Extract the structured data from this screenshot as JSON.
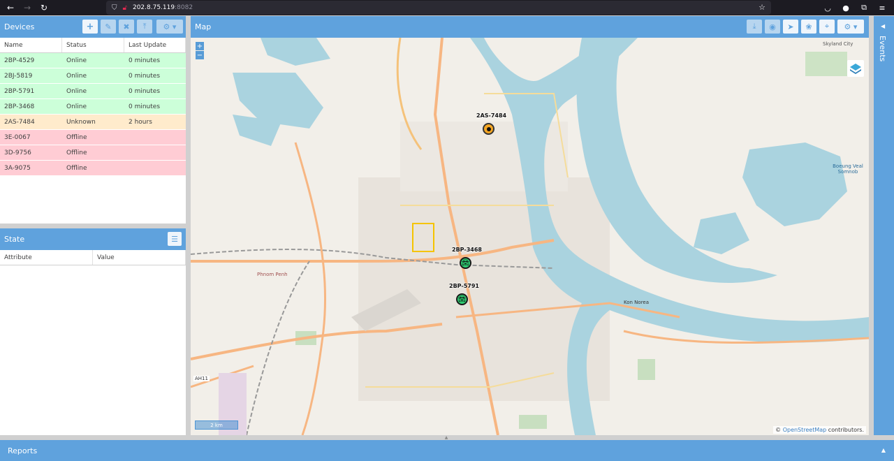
{
  "browser": {
    "url_host": "202.8.75.119",
    "url_port": ":8082"
  },
  "devices": {
    "title": "Devices",
    "columns": [
      "Name",
      "Status",
      "Last Update"
    ],
    "rows": [
      {
        "name": "2BP-4529",
        "status": "Online",
        "last_update": "0 minutes",
        "state": "online"
      },
      {
        "name": "2BJ-5819",
        "status": "Online",
        "last_update": "0 minutes",
        "state": "online"
      },
      {
        "name": "2BP-5791",
        "status": "Online",
        "last_update": "0 minutes",
        "state": "online"
      },
      {
        "name": "2BP-3468",
        "status": "Online",
        "last_update": "0 minutes",
        "state": "online"
      },
      {
        "name": "2AS-7484",
        "status": "Unknown",
        "last_update": "2 hours",
        "state": "unknown"
      },
      {
        "name": "3E-0067",
        "status": "Offline",
        "last_update": "",
        "state": "offline"
      },
      {
        "name": "3D-9756",
        "status": "Offline",
        "last_update": "",
        "state": "offline"
      },
      {
        "name": "3A-9075",
        "status": "Offline",
        "last_update": "",
        "state": "offline"
      }
    ],
    "toolbar_icons": [
      "add-icon",
      "edit-icon",
      "remove-icon",
      "upload-icon",
      "settings-icon"
    ]
  },
  "state": {
    "title": "State",
    "columns": [
      "Attribute",
      "Value"
    ]
  },
  "map": {
    "title": "Map",
    "zoom_in": "+",
    "zoom_out": "−",
    "scale_label": "2 km",
    "attribution_prefix": "©",
    "attribution_link": "OpenStreetMap",
    "attribution_suffix": "contributors.",
    "map_labels": [
      "Kon Norea",
      "Boeung Veal Somnob",
      "Skyland City",
      "Phnom Penh",
      "AH11"
    ],
    "markers": [
      {
        "label": "2AS-7484",
        "status_color": "#f5a623"
      },
      {
        "label": "2BP-3468",
        "status_color": "#2ecc71"
      },
      {
        "label": "2BP-5791",
        "status_color": "#2ecc71"
      }
    ]
  },
  "events": {
    "title": "Events"
  },
  "reports": {
    "title": "Reports"
  },
  "colors": {
    "accent": "#5fa2dd",
    "online_row": "#ccffd9",
    "unknown_row": "#ffebcc",
    "offline_row": "#ffccd4"
  }
}
